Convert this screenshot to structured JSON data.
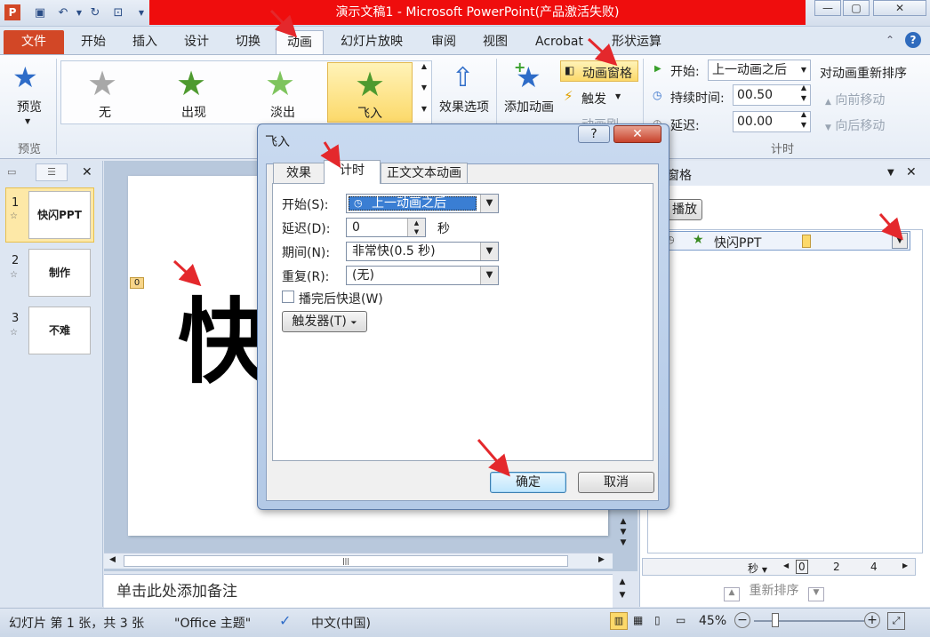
{
  "window": {
    "title": "演示文稿1 - Microsoft PowerPoint(产品激活失败)"
  },
  "tabs": [
    "文件",
    "开始",
    "插入",
    "设计",
    "切换",
    "动画",
    "幻灯片放映",
    "审阅",
    "视图",
    "Acrobat",
    "形状运算"
  ],
  "ribbon": {
    "preview": {
      "label": "预览",
      "group": "预览"
    },
    "gallery": [
      "无",
      "出现",
      "淡出",
      "飞入"
    ],
    "effect_options": "效果选项",
    "add_animation": "添加动画",
    "animation_pane": "动画窗格",
    "trigger": "触发",
    "animation_painter": "动画刷",
    "start_label": "开始:",
    "start_value": "上一动画之后",
    "duration_label": "持续时间:",
    "duration_value": "00.50",
    "delay_label": "延迟:",
    "delay_value": "00.00",
    "timing_group": "计时",
    "reorder_title": "对动画重新排序",
    "move_earlier": "向前移动",
    "move_later": "向后移动",
    "group_anim_partial": "动"
  },
  "slides": [
    {
      "num": "1",
      "text": "快闪PPT"
    },
    {
      "num": "2",
      "text": "制作"
    },
    {
      "num": "3",
      "text": "不难"
    }
  ],
  "slide": {
    "big_text": "快",
    "anim_tag": "0"
  },
  "notes_placeholder": "单击此处添加备注",
  "anim_pane": {
    "title": "窗格",
    "play": "播放",
    "item": "快闪PPT",
    "seconds": "秒",
    "timeline": [
      "0",
      "2",
      "4"
    ],
    "reorder": "重新排序"
  },
  "status": {
    "slide_info": "幻灯片 第 1 张，共 3 张",
    "theme": "\"Office 主题\"",
    "language": "中文(中国)",
    "zoom": "45%"
  },
  "dialog": {
    "title": "飞入",
    "tabs": [
      "效果",
      "计时",
      "正文文本动画"
    ],
    "start_label": "开始(S):",
    "start_value": "上一动画之后",
    "delay_label": "延迟(D):",
    "delay_value": "0",
    "delay_unit": "秒",
    "period_label": "期间(N):",
    "period_value": "非常快(0.5 秒)",
    "repeat_label": "重复(R):",
    "repeat_value": "(无)",
    "rewind_label": "播完后快退(W)",
    "trigger_label": "触发器(T)",
    "ok": "确定",
    "cancel": "取消"
  }
}
